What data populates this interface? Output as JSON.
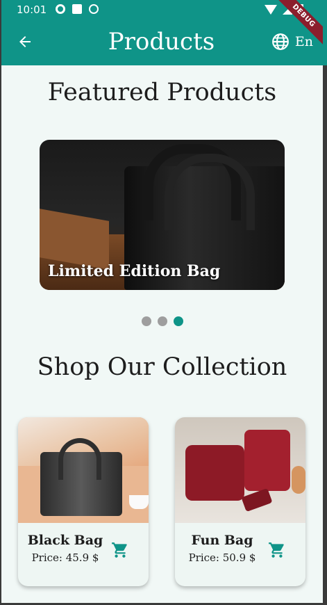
{
  "status_bar": {
    "time": "10:01",
    "icons": [
      "gear-icon",
      "sd-card-icon",
      "at-icon",
      "wifi-icon",
      "signal-icon",
      "battery-icon"
    ]
  },
  "app_bar": {
    "title": "Products",
    "language_label": "En",
    "debug_banner": "DEBUG"
  },
  "featured": {
    "title": "Featured Products",
    "slide_caption": "Limited Edition Bag",
    "dots": 3,
    "active_dot": 3
  },
  "collection": {
    "title": "Shop Our Collection",
    "products": [
      {
        "name": "Black Bag",
        "price": "Price: 45.9 $"
      },
      {
        "name": "Fun Bag",
        "price": "Price: 50.9 $"
      }
    ]
  },
  "colors": {
    "primary": "#0f9488",
    "background": "#f1f8f6",
    "debug_banner": "#8b1e2c"
  }
}
